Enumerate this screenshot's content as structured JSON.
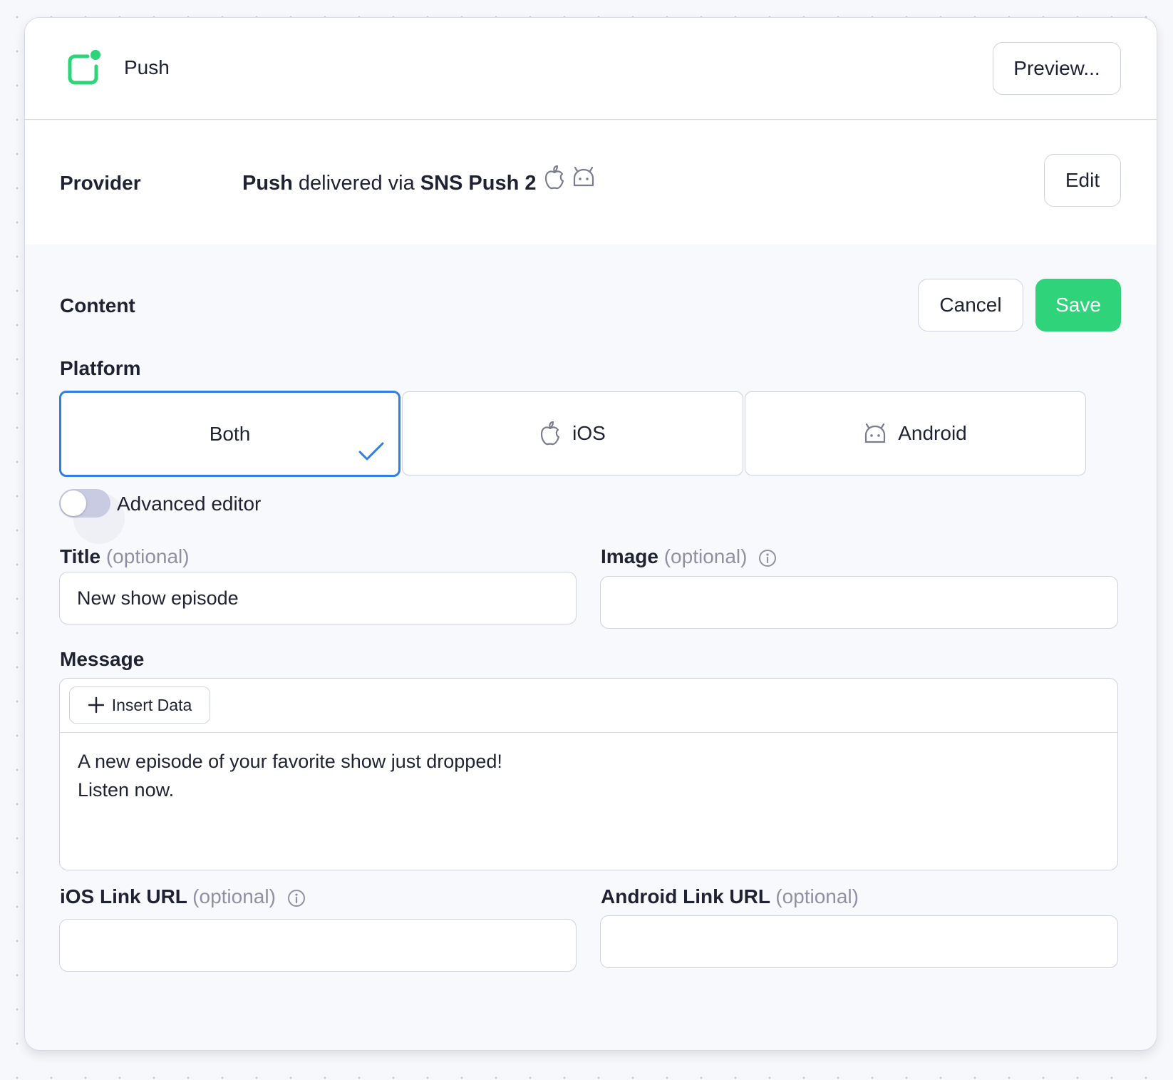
{
  "header": {
    "title": "Push",
    "icon": "push-notification-icon",
    "preview_label": "Preview..."
  },
  "provider": {
    "label": "Provider",
    "channel": "Push",
    "via_text": "delivered via",
    "service": "SNS Push 2",
    "platform_icons": [
      "apple-icon",
      "android-icon"
    ],
    "edit_label": "Edit"
  },
  "content": {
    "label": "Content",
    "cancel_label": "Cancel",
    "save_label": "Save",
    "save_color": "#2fd47a"
  },
  "platform": {
    "label": "Platform",
    "options": [
      {
        "label": "Both",
        "selected": true
      },
      {
        "label": "iOS",
        "icon": "apple-icon"
      },
      {
        "label": "Android",
        "icon": "android-icon"
      }
    ],
    "selected_color": "#2f7fe0"
  },
  "advanced_editor": {
    "label": "Advanced editor",
    "enabled": false
  },
  "fields": {
    "optional": "(optional)",
    "title": {
      "label": "Title",
      "value": "New show episode"
    },
    "image": {
      "label": "Image",
      "value": ""
    },
    "message": {
      "label": "Message",
      "insert_label": "Insert Data",
      "value": "A new episode of your favorite show just dropped!\nListen now."
    },
    "ios_link": {
      "label": "iOS Link URL",
      "value": ""
    },
    "android_link": {
      "label": "Android Link URL",
      "value": ""
    }
  }
}
